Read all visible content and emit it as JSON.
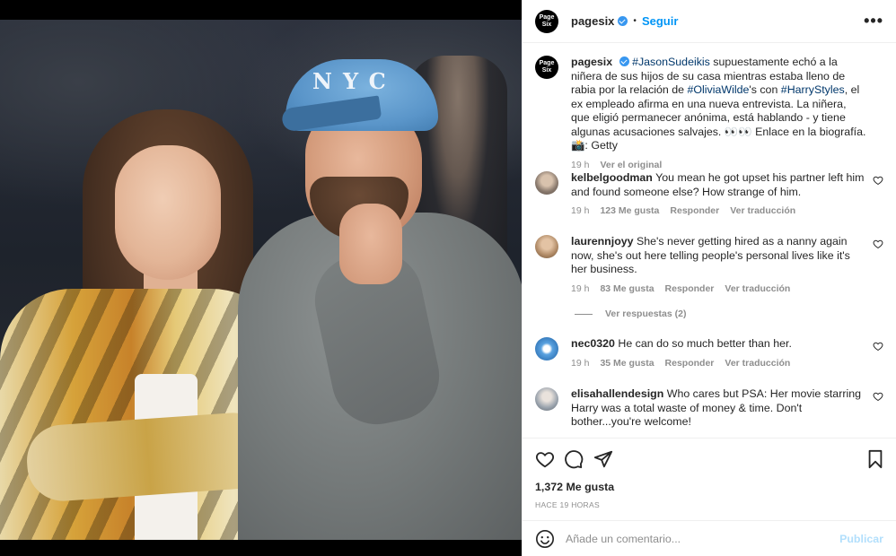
{
  "post": {
    "author": "pagesix",
    "avatar_text": "Page Six",
    "follow_label": "Seguir",
    "separator": "•",
    "more_label": "•••"
  },
  "caption": {
    "user": "pagesix",
    "tag1": "#JasonSudeikis",
    "text1": " supuestamente echó a la niñera de sus hijos de su casa mientras estaba lleno de rabia por la relación de ",
    "tag2": "#OliviaWilde",
    "text2": "'s con ",
    "tag3": "#HarryStyles",
    "text3": ", el ex empleado afirma en una nueva entrevista. La niñera, que eligió permanecer anónima, está hablando - y tiene algunas acusaciones salvajes. 👀👀 Enlace en la biografía. 📸: Getty",
    "time": "19 h",
    "see_original": "Ver el original"
  },
  "comments": [
    {
      "user": "kelbelgoodman",
      "text": "You mean he got upset his partner left him and found someone else? How strange of him.",
      "time": "19 h",
      "likes": "123 Me gusta",
      "reply": "Responder",
      "translate": "Ver traducción",
      "avatar_color": "#8a7a6e"
    },
    {
      "user": "laurennjoyy",
      "text": "She's never getting hired as a nanny again now, she's out here telling people's personal lives like it's her business.",
      "time": "19 h",
      "likes": "83 Me gusta",
      "reply": "Responder",
      "translate": "Ver traducción",
      "avatar_color": "#b08a66"
    },
    {
      "user": "nec0320",
      "text": "He can do so much better than her.",
      "time": "19 h",
      "likes": "35 Me gusta",
      "reply": "Responder",
      "translate": "Ver traducción",
      "avatar_color": "#2f6fb0"
    },
    {
      "user": "elisahallendesign",
      "text": "Who cares but PSA: Her movie starring Harry was a total waste of money & time. Don't bother...you're welcome!",
      "avatar_color": "#9aa3ad"
    }
  ],
  "view_replies": "Ver respuestas (2)",
  "actions": {
    "likes": "1,372 Me gusta",
    "time_ago": "HACE 19 HORAS",
    "icons": [
      "heart-icon",
      "comment-icon",
      "share-icon",
      "bookmark-icon"
    ]
  },
  "composer": {
    "placeholder": "Añade un comentario...",
    "publish_label": "Publicar"
  },
  "photo": {
    "cap_logo": "NYC"
  },
  "colors": {
    "link": "#00376b",
    "accent": "#0095f6",
    "muted": "#8e8e8e"
  }
}
